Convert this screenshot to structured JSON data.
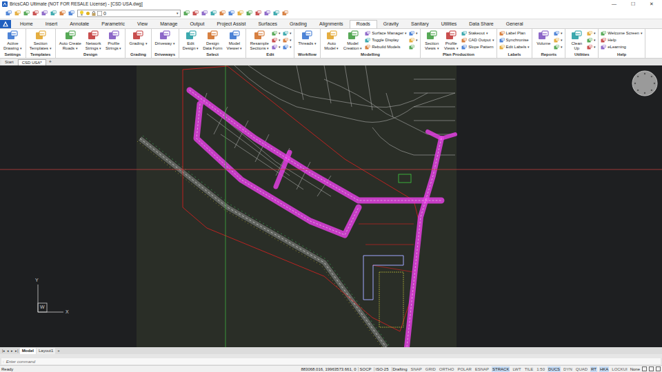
{
  "window": {
    "title": "BricsCAD Ultimate (NOT FOR RESALE License) - [CSD USA.dwg]",
    "controls": [
      "—",
      "☐",
      "✕"
    ]
  },
  "quick_access": {
    "layer": "0"
  },
  "ribbon_tabs": [
    {
      "label": "Home",
      "selected": false
    },
    {
      "label": "Insert",
      "selected": false
    },
    {
      "label": "Annotate",
      "selected": false
    },
    {
      "label": "Parametric",
      "selected": false
    },
    {
      "label": "View",
      "selected": false
    },
    {
      "label": "Manage",
      "selected": false
    },
    {
      "label": "Output",
      "selected": false
    },
    {
      "label": "Project Assist",
      "selected": false
    },
    {
      "label": "Surfaces",
      "selected": false
    },
    {
      "label": "Grading",
      "selected": false
    },
    {
      "label": "Alignments",
      "selected": false
    },
    {
      "label": "Roads",
      "selected": true
    },
    {
      "label": "Gravity",
      "selected": false
    },
    {
      "label": "Sanitary",
      "selected": false
    },
    {
      "label": "Utilities",
      "selected": false
    },
    {
      "label": "Data Share",
      "selected": false
    },
    {
      "label": "General",
      "selected": false
    }
  ],
  "ribbon": {
    "dropdown_glyph": "▾",
    "groups": [
      {
        "label": "Settings",
        "items": [
          {
            "kind": "large",
            "lines": [
              "Active",
              "Drawing"
            ],
            "dropdown": true
          }
        ]
      },
      {
        "label": "Templates",
        "items": [
          {
            "kind": "large",
            "lines": [
              "Section",
              "Templates"
            ],
            "dropdown": true
          }
        ]
      },
      {
        "label": "Design",
        "items": [
          {
            "kind": "large",
            "lines": [
              "Auto Create",
              "Roads"
            ],
            "dropdown": true
          },
          {
            "kind": "large",
            "lines": [
              "Network",
              "Strings"
            ],
            "dropdown": true
          },
          {
            "kind": "large",
            "lines": [
              "Profile",
              "Strings"
            ],
            "dropdown": true
          }
        ]
      },
      {
        "label": "Grading",
        "items": [
          {
            "kind": "large",
            "lines": [
              "Grading"
            ],
            "dropdown": true
          }
        ]
      },
      {
        "label": "Driveways",
        "items": [
          {
            "kind": "large",
            "lines": [
              "Driveway"
            ],
            "dropdown": true
          }
        ]
      },
      {
        "label": "Select",
        "items": [
          {
            "kind": "large",
            "lines": [
              "Edit",
              "Design"
            ],
            "dropdown": true
          },
          {
            "kind": "large",
            "lines": [
              "Design",
              "Data Form"
            ],
            "dropdown": false
          },
          {
            "kind": "large",
            "lines": [
              "Model",
              "Viewer"
            ],
            "dropdown": true
          }
        ]
      },
      {
        "label": "Edit",
        "items": [
          {
            "kind": "large",
            "lines": [
              "Resample",
              "Sections"
            ],
            "dropdown": true
          },
          {
            "kind": "icon",
            "dropdown": true
          },
          {
            "kind": "icon",
            "dropdown": true
          },
          {
            "kind": "icon",
            "dropdown": true
          },
          {
            "kind": "icon",
            "dropdown": true
          },
          {
            "kind": "icon",
            "dropdown": true
          },
          {
            "kind": "icon",
            "dropdown": true
          }
        ]
      },
      {
        "label": "Workflow",
        "items": [
          {
            "kind": "large",
            "lines": [
              "Threads"
            ],
            "dropdown": true
          }
        ]
      },
      {
        "label": "Modelling",
        "items": [
          {
            "kind": "large",
            "lines": [
              "Auto",
              "Model"
            ],
            "dropdown": true
          },
          {
            "kind": "large",
            "lines": [
              "Model",
              "Creation"
            ],
            "dropdown": true
          },
          {
            "kind": "small",
            "label": "Surface Manager",
            "dropdown": true
          },
          {
            "kind": "small",
            "label": "Toggle Display",
            "dropdown": false
          },
          {
            "kind": "small",
            "label": "Rebuild Models",
            "dropdown": false
          },
          {
            "kind": "icon",
            "dropdown": true
          },
          {
            "kind": "icon",
            "dropdown": true
          },
          {
            "kind": "icon",
            "dropdown": false
          }
        ]
      },
      {
        "label": "Plan Production",
        "items": [
          {
            "kind": "large",
            "lines": [
              "Section",
              "Views"
            ],
            "dropdown": true
          },
          {
            "kind": "large",
            "lines": [
              "Profile",
              "Views"
            ],
            "dropdown": true
          },
          {
            "kind": "small",
            "label": "Stakeout",
            "dropdown": true
          },
          {
            "kind": "small",
            "label": "CAD Output",
            "dropdown": true
          },
          {
            "kind": "small",
            "label": "Slope Pattern",
            "dropdown": false
          }
        ]
      },
      {
        "label": "Labels",
        "items": [
          {
            "kind": "small",
            "label": "Label Plan",
            "dropdown": false
          },
          {
            "kind": "small",
            "label": "Synchronise",
            "dropdown": false
          },
          {
            "kind": "small",
            "label": "Edit Labels",
            "dropdown": true
          }
        ]
      },
      {
        "label": "Reports",
        "items": [
          {
            "kind": "large",
            "lines": [
              "Volume"
            ],
            "dropdown": false
          },
          {
            "kind": "icon",
            "dropdown": true
          },
          {
            "kind": "icon",
            "dropdown": true
          },
          {
            "kind": "icon",
            "dropdown": true
          }
        ]
      },
      {
        "label": "Utilities",
        "items": [
          {
            "kind": "large",
            "lines": [
              "Clean",
              "Up"
            ],
            "dropdown": false
          },
          {
            "kind": "icon",
            "dropdown": true
          },
          {
            "kind": "icon",
            "dropdown": true
          },
          {
            "kind": "icon",
            "dropdown": true
          }
        ]
      },
      {
        "label": "Help",
        "items": [
          {
            "kind": "small",
            "label": "Welcome Screen",
            "dropdown": true
          },
          {
            "kind": "small",
            "label": "Help",
            "dropdown": false
          },
          {
            "kind": "small",
            "label": "eLearning",
            "dropdown": false
          }
        ]
      }
    ]
  },
  "doc_tabs": [
    {
      "label": "Start",
      "selected": false
    },
    {
      "label": "CSD USA*",
      "selected": true
    }
  ],
  "new_tab": "+",
  "ucs": {
    "y": "Y",
    "origin": "W",
    "x": "X"
  },
  "layout_nav": [
    "|◂",
    "◂",
    "▸",
    "▸|"
  ],
  "layout_tabs": [
    {
      "label": "Model",
      "selected": true
    },
    {
      "label": "Layout1",
      "selected": false
    }
  ],
  "command": {
    "prompt": ":",
    "placeholder": "Enter command"
  },
  "status_bar": {
    "state": "Ready",
    "coordinates": "883068.016, 19963573.661, 0",
    "fields": [
      "SOCP",
      "ISO-25",
      "Drafting"
    ],
    "toggles": [
      {
        "label": "SNAP",
        "on": false
      },
      {
        "label": "GRID",
        "on": false
      },
      {
        "label": "ORTHO",
        "on": false
      },
      {
        "label": "POLAR",
        "on": false
      },
      {
        "label": "ESNAP",
        "on": false
      },
      {
        "label": "STRACK",
        "on": true
      },
      {
        "label": "LWT",
        "on": false
      },
      {
        "label": "TILE",
        "on": false
      },
      {
        "label": "1:50",
        "on": false
      },
      {
        "label": "DUCS",
        "on": true
      },
      {
        "label": "DYN",
        "on": false
      },
      {
        "label": "QUAD",
        "on": false
      },
      {
        "label": "RT",
        "on": true
      },
      {
        "label": "HKA",
        "on": true
      },
      {
        "label": "LOCKUI",
        "on": false
      }
    ],
    "end": "None"
  }
}
